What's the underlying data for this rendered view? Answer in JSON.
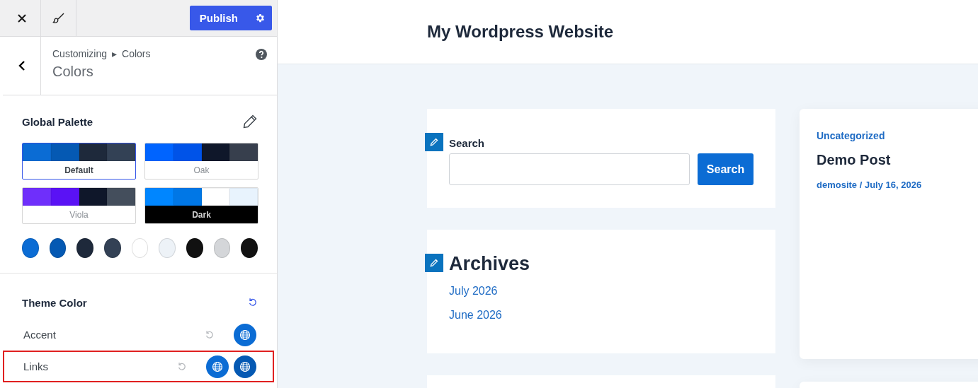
{
  "top_bar": {
    "publish_label": "Publish"
  },
  "header": {
    "breadcrumb": [
      "Customizing",
      "▸",
      "Colors"
    ],
    "title": "Colors"
  },
  "global_palette": {
    "title": "Global Palette",
    "palettes": [
      {
        "name": "Default",
        "kind": "light",
        "selected": true,
        "colors": [
          {
            "color": "#0b6cd4"
          },
          {
            "color": "#0559b3"
          },
          {
            "color": "#1e293b"
          },
          {
            "color": "#334155"
          }
        ]
      },
      {
        "name": "Oak",
        "kind": "light",
        "selected": false,
        "colors": [
          {
            "color": "#0064ff"
          },
          {
            "color": "#0053e8"
          },
          {
            "color": "#0f172a"
          },
          {
            "color": "#373f4d"
          }
        ]
      },
      {
        "name": "Viola",
        "kind": "light",
        "selected": false,
        "colors": [
          {
            "color": "#6f2ffb"
          },
          {
            "color": "#5a12f5"
          },
          {
            "color": "#0f172a"
          },
          {
            "color": "#444e5c"
          }
        ]
      },
      {
        "name": "Dark",
        "kind": "dark",
        "selected": false,
        "colors": [
          {
            "color": "#0086ff"
          },
          {
            "color": "#0077e6"
          },
          {
            "color": "#ffffff"
          },
          {
            "color": "#e8f3fd"
          }
        ]
      }
    ],
    "swatches": [
      {
        "color": "#0b6cd4"
      },
      {
        "color": "#0559b3"
      },
      {
        "color": "#1e293b"
      },
      {
        "color": "#334155"
      },
      {
        "color": "#ffffff"
      },
      {
        "color": "#edf2f7"
      },
      {
        "color": "#111111"
      },
      {
        "color": "#d4d6d9"
      },
      {
        "color": "#121212"
      }
    ]
  },
  "theme_color": {
    "title": "Theme Color",
    "rows": [
      {
        "label": "Accent",
        "highlighted": false,
        "buttons": [
          {
            "color": "#0b6cd4"
          }
        ]
      },
      {
        "label": "Links",
        "highlighted": true,
        "buttons": [
          {
            "color": "#0b6cd4"
          },
          {
            "color": "#0559b3"
          }
        ]
      }
    ]
  },
  "preview": {
    "site_title": "My Wordpress Website",
    "search_widget": {
      "label": "Search",
      "button": "Search"
    },
    "archives_widget": {
      "title": "Archives",
      "links": [
        "July 2026",
        "June 2026"
      ]
    },
    "post": {
      "category": "Uncategorized",
      "title": "Demo Post",
      "meta": "demosite / July 16, 2026"
    }
  }
}
